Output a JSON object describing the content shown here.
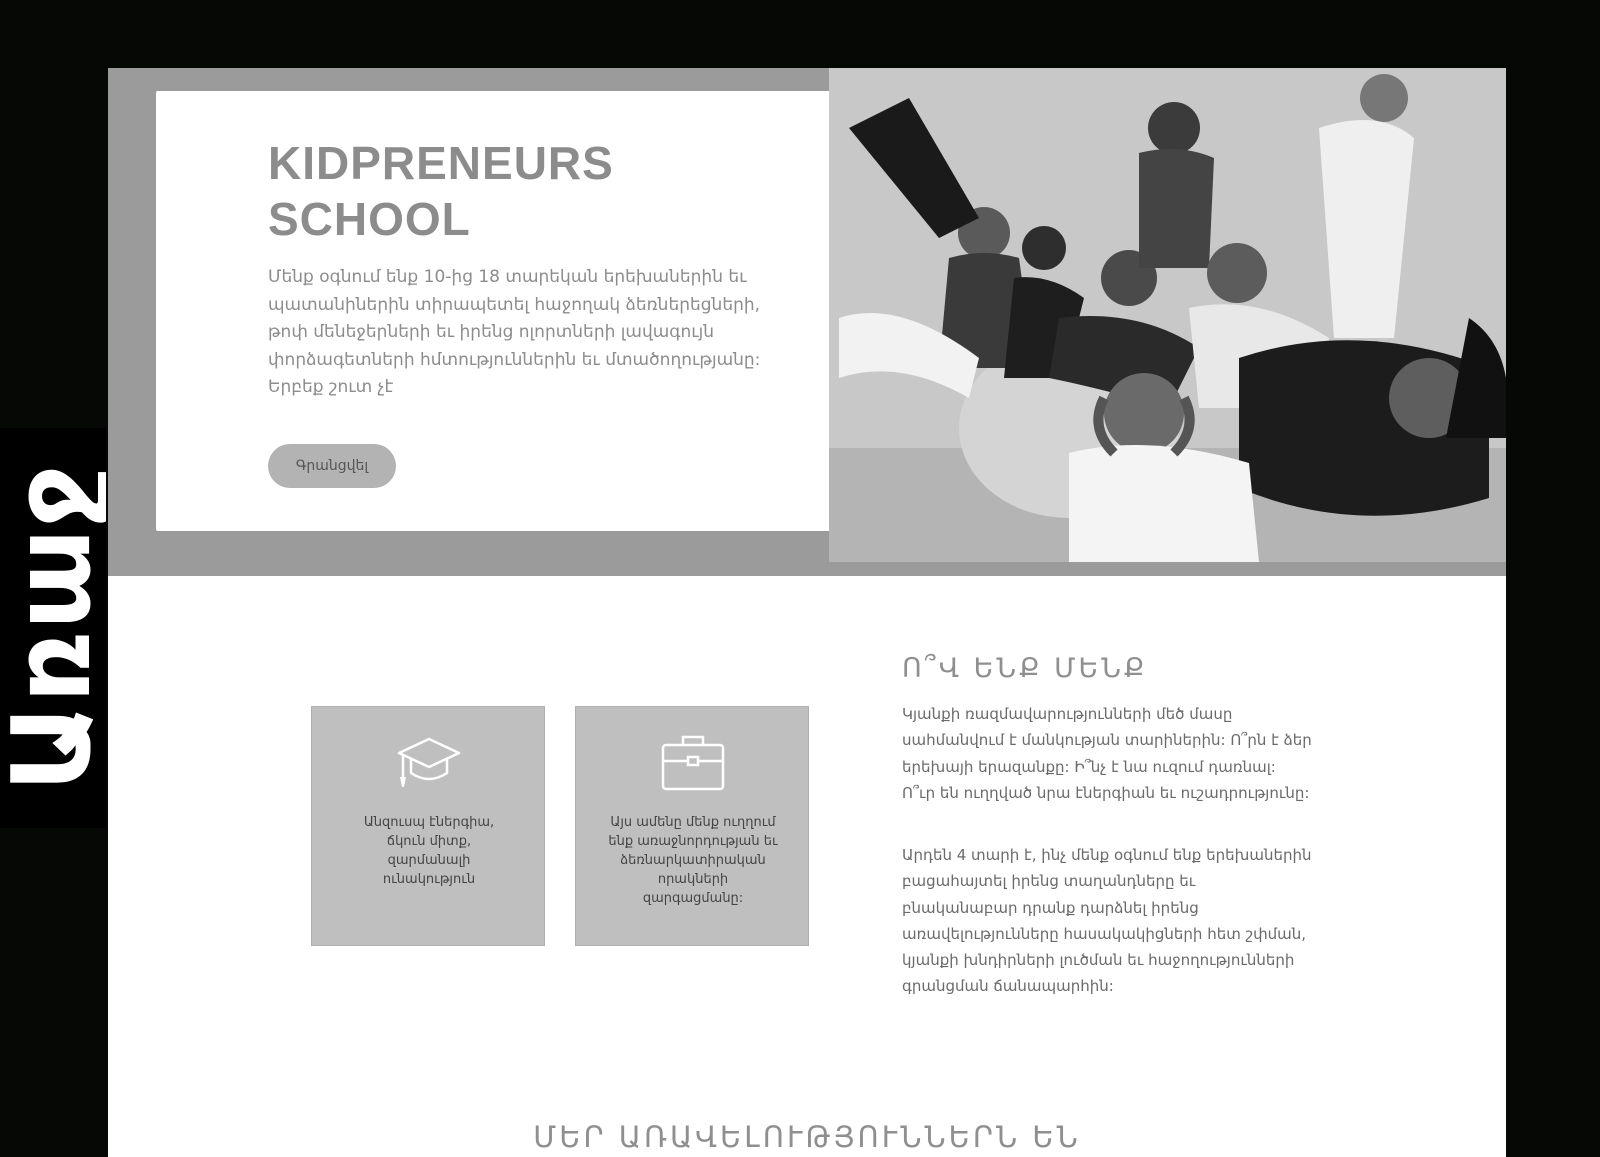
{
  "side_tab": {
    "label": "Առաջ"
  },
  "hero": {
    "title_line1": "KIDPRENEURS",
    "title_line2": "SCHOOL",
    "description": "Մենք օգնում ենք 10-ից 18 տարեկան երեխաներին եւ պատանիներին տիրապետել հաջողակ ձեռներեցների, թոփ մենեջերների եւ իրենց ոլորտների լավագույն փորձագետների հմտություններին եւ մտածողությանը: Երբեք շուտ չէ",
    "button_label": "Գրանցվել",
    "photo_icon": "group-photo-kids"
  },
  "features": [
    {
      "icon": "graduation-cap-icon",
      "text": "Անզուսպ էներգիա, ճկուն միտք, զարմանալի ունակություն"
    },
    {
      "icon": "briefcase-icon",
      "text": "Այս ամենը մենք ուղղում ենք առաջնորդության եւ ձեռնարկատիրական որակների զարգացմանը:"
    }
  ],
  "about": {
    "title": "Ո՞Վ ԵՆՔ ՄԵՆՔ",
    "paragraph1": "Կյանքի ռազմավարությունների մեծ մասը սահմանվում է մանկության տարիներին: Ո՞րն է ձեր երեխայի երազանքը: Ի՞նչ է նա ուզում դառնալ: Ո՞ւր են ուղղված նրա էներգիան եւ ուշադրությունը:",
    "paragraph2": "Արդեն 4 տարի է, ինչ մենք օգնում ենք երեխաներին բացահայտել իրենց տաղանդները եւ բնականաբար դրանք դարձնել իրենց առավելությունները հասակակիցների հետ շփման, կյանքի խնդիրների լուծման եւ հաջողությունների գրանցման ճանապարհին:"
  },
  "advantages": {
    "title": "ՄԵՐ ԱՌԱՎԵԼՈՒԹՅՈՒՆՆԵՐՆ ԵՆ"
  },
  "colors": {
    "frame": "#050805",
    "hero_band": "#9b9b9b",
    "card_gray": "#bfbfbf",
    "text_gray": "#8c8c8c",
    "button_gray": "#b3b3b3"
  }
}
